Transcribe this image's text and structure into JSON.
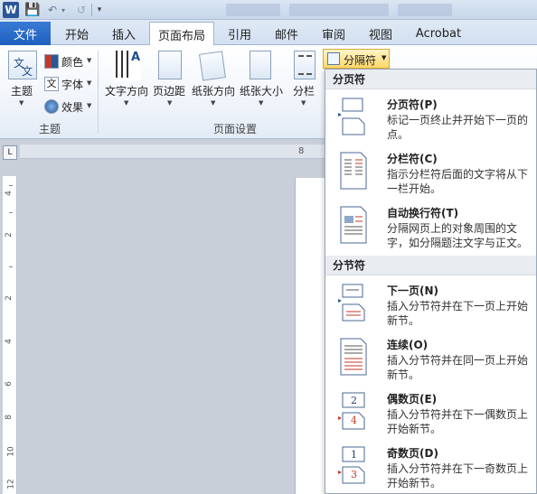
{
  "titlebar": {
    "app_icon_letter": "W"
  },
  "tabs": {
    "file": "文件",
    "items": [
      "开始",
      "插入",
      "页面布局",
      "引用",
      "邮件",
      "审阅",
      "视图",
      "Acrobat"
    ]
  },
  "ribbon": {
    "theme_group": {
      "theme_label": "主题",
      "colors_label": "颜色",
      "fonts_label": "字体",
      "effects_label": "效果",
      "group_label": "主题"
    },
    "page_setup": {
      "text_direction": "文字方向",
      "margins": "页边距",
      "orientation": "纸张方向",
      "size": "纸张大小",
      "columns": "分栏",
      "group_label": "页面设置"
    },
    "breaks_label": "分隔符"
  },
  "ruler": {
    "h_number": "8",
    "v_numbers": [
      "4",
      "2",
      "2",
      "4",
      "6",
      "8",
      "10",
      "12"
    ]
  },
  "menu": {
    "sections": [
      {
        "header": "分页符",
        "items": [
          {
            "title": "分页符(P)",
            "desc": "标记一页终止并开始下一页的点。",
            "icon": "page-break-icon"
          },
          {
            "title": "分栏符(C)",
            "desc": "指示分栏符后面的文字将从下一栏开始。",
            "icon": "column-break-icon"
          },
          {
            "title": "自动换行符(T)",
            "desc": "分隔网页上的对象周围的文字，如分隔题注文字与正文。",
            "icon": "text-wrapping-break-icon"
          }
        ]
      },
      {
        "header": "分节符",
        "items": [
          {
            "title": "下一页(N)",
            "desc": "插入分节符并在下一页上开始新节。",
            "icon": "next-page-section-icon"
          },
          {
            "title": "连续(O)",
            "desc": "插入分节符并在同一页上开始新节。",
            "icon": "continuous-section-icon"
          },
          {
            "title": "偶数页(E)",
            "desc": "插入分节符并在下一偶数页上开始新节。",
            "icon": "even-page-section-icon"
          },
          {
            "title": "奇数页(D)",
            "desc": "插入分节符并在下一奇数页上开始新节。",
            "icon": "odd-page-section-icon"
          }
        ]
      }
    ],
    "even_icon_numbers": [
      "2",
      "4"
    ],
    "odd_icon_numbers": [
      "1",
      "3"
    ]
  },
  "colors": {
    "accent": "#1f5fbf",
    "highlight": "#ffd86a",
    "red_mark": "#c0392b"
  }
}
